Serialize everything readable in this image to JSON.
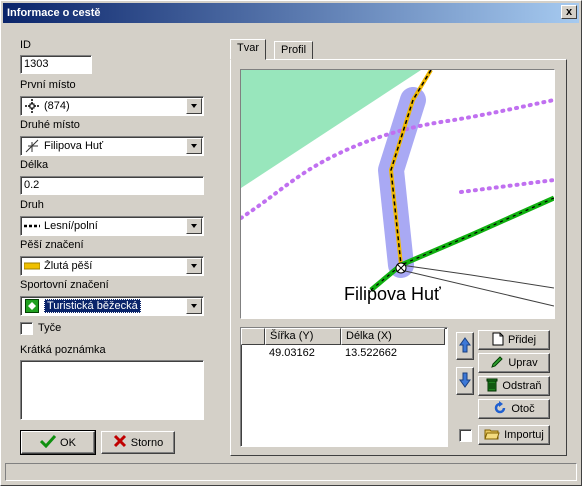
{
  "window": {
    "title": "Informace o cestě",
    "close_glyph": "x"
  },
  "form": {
    "id_label": "ID",
    "id_value": "1303",
    "first_place_label": "První místo",
    "first_place_value": "(874)",
    "first_place_icon": "crossroad-icon",
    "second_place_label": "Druhé místo",
    "second_place_value": "Filipova Huť",
    "second_place_icon": "junction-icon",
    "length_label": "Délka",
    "length_value": "0.2",
    "type_label": "Druh",
    "type_value": "Lesní/polní",
    "type_icon": "dashed-line-icon",
    "hiking_label": "Pěší značení",
    "hiking_value": "Žlutá pěší",
    "hiking_icon": "yellow-trail-icon",
    "sport_label": "Sportovní značení",
    "sport_value": "Turistická běžecká",
    "sport_icon": "ski-trail-icon",
    "poles_label": "Tyče",
    "poles_checked": false,
    "note_label": "Krátká poznámka",
    "note_value": ""
  },
  "buttons": {
    "ok": "OK",
    "cancel": "Storno"
  },
  "tabs": [
    {
      "label": "Tvar",
      "active": true
    },
    {
      "label": "Profil",
      "active": false
    }
  ],
  "map": {
    "place_label": "Filipova Huť",
    "colors": {
      "forest": "#98e6bc",
      "route_highlight": "#8c8cf0",
      "yellow_trail": "#f0b800",
      "purple_trail": "#c070f0",
      "green_trail": "#10b010"
    }
  },
  "table": {
    "columns": [
      "Šířka (Y)",
      "Délka (X)"
    ],
    "rows": [
      [
        "49.03162",
        "13.522662"
      ]
    ]
  },
  "side_buttons": {
    "add": "Přidej",
    "edit": "Uprav",
    "delete": "Odstraň",
    "rotate": "Otoč",
    "import": "Importuj"
  },
  "import_checked": false,
  "status": ""
}
